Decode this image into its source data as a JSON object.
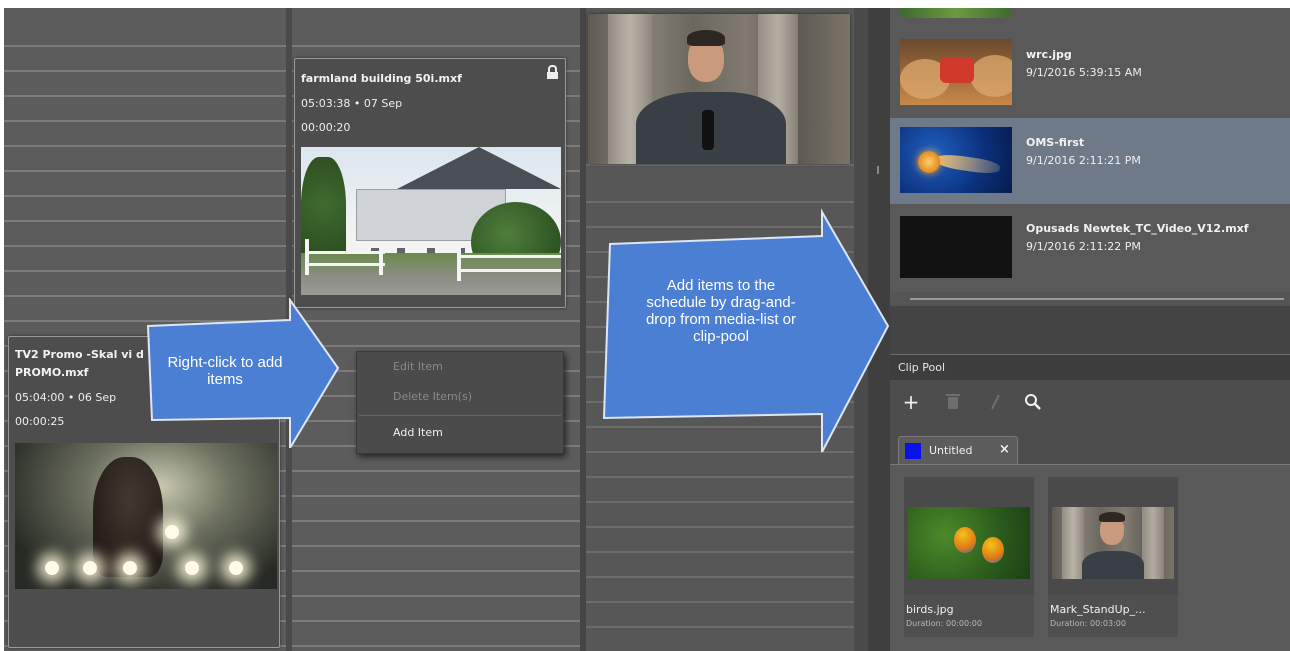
{
  "schedule": {
    "card_farmland": {
      "title": "farmland building 50i.mxf",
      "time": "05:03:38 • 07 Sep",
      "duration": "00:00:20"
    },
    "card_tv2": {
      "title_line1": "TV2 Promo -Skal vi d",
      "title_line2": "PROMO.mxf",
      "time": "05:04:00 • 06 Sep",
      "duration": "00:00:25"
    }
  },
  "context_menu": {
    "items": [
      {
        "label": "Edit Item",
        "enabled": false
      },
      {
        "label": "Delete Item(s)",
        "enabled": false
      },
      {
        "label": "Add Item",
        "enabled": true
      }
    ]
  },
  "callouts": {
    "right_click": "Right-click to add items",
    "drag_drop": "Add items to the schedule by drag-and-drop from media-list or clip-pool",
    "color": "#4a7fd4"
  },
  "media_list": {
    "items": [
      {
        "name": "wrc.jpg",
        "date": "9/1/2016 5:39:15 AM",
        "selected": false
      },
      {
        "name": "OMS-first",
        "date": "9/1/2016 2:11:21 PM",
        "selected": true
      },
      {
        "name": "Opusads Newtek_TC_Video_V12.mxf",
        "date": "9/1/2016 2:11:22 PM",
        "selected": false
      }
    ]
  },
  "clip_pool": {
    "title": "Clip Pool",
    "toolbar": {
      "add_icon": "plus-icon",
      "delete_icon": "trash-icon",
      "edit_icon": "pencil-icon",
      "search_icon": "search-icon"
    },
    "tab": {
      "label": "Untitled",
      "close": "×",
      "swatch_color": "#0a12e8"
    },
    "clips": [
      {
        "name": "birds.jpg",
        "duration": "Duration: 00:00:00"
      },
      {
        "name": "Mark_StandUp_...",
        "duration": "Duration: 00:03:00"
      }
    ]
  }
}
